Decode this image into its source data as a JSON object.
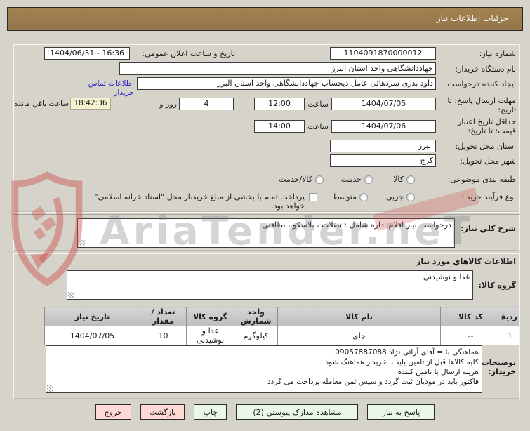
{
  "colors": {
    "header_bg": "#9a7b50",
    "button_green": "#e9f8e9",
    "button_pink": "#fdd8d4",
    "highlight_yellow": "#f6f1cf",
    "link_blue": "#2a24c8"
  },
  "watermark": {
    "text": "AriaTender.neT"
  },
  "header": {
    "title": "جزئیات اطلاعات نیاز"
  },
  "fields": {
    "need_number": {
      "label": "شماره نیاز:",
      "value": "1104091870000012"
    },
    "announce": {
      "label": "تاریخ و ساعت اعلان عمومی:",
      "value": "1404/06/31 - 16:36"
    },
    "buyer_org": {
      "label": "نام دستگاه خریدار:",
      "value": "جهاددانشگاهی واحد استان البرز"
    },
    "creator": {
      "label": "ایجاد کننده درخواست:",
      "value": "داود بدری سردهائی عامل ذیحساب جهاددانشگاهی واحد استان البرز"
    },
    "buyer_contact_link": "اطلاعات تماس خریدار",
    "deadline": {
      "label": "مهلت ارسال پاسخ: تا تاریخ:",
      "date": "1404/07/05",
      "hour_label": "ساعت",
      "time": "12:00",
      "days_value": "4",
      "days_label": "روز و",
      "remaining": "18:42:36",
      "remaining_label": "ساعت باقي مانده"
    },
    "price_validity": {
      "label": "حداقل تاریخ اعتبار قیمت: تا تاریخ:",
      "date": "1404/07/06",
      "hour_label": "ساعت",
      "time": "14:00"
    },
    "province": {
      "label": "استان محل تحویل:",
      "value": "البرز"
    },
    "city": {
      "label": "شهر محل تحویل:",
      "value": "کرج"
    },
    "subject_class": {
      "label": "طبقه بندی موضوعی:",
      "options": [
        "کالا",
        "خدمت",
        "کالا/خدمت"
      ]
    },
    "process_type": {
      "label": "نوع فرآیند خرید :",
      "options": [
        "جزیی",
        "متوسط"
      ],
      "checkbox_label": "پرداخت تمام یا بخشی از مبلغ خرید،از محل \"اسناد خزانه اسلامی\" خواهد بود."
    }
  },
  "need_desc": {
    "label": "شرح کلي نیاز:",
    "value": "درخواست نیاز اقلام اداره شامل : تنقلات ، پلاسکو ، نظافتی"
  },
  "goods": {
    "section_title": "اطلاعات کالاهاي مورد نیاز",
    "group_label": "گروه کالا:",
    "group_value": "غذا و نوشیدنی",
    "table": {
      "headers": [
        "ردیف",
        "کد کالا",
        "نام کالا",
        "واحد شمارش",
        "گروه کالا",
        "تعداد / مقدار",
        "تاریخ نیاز"
      ],
      "rows": [
        [
          "1",
          "--",
          "چای",
          "کیلوگرم",
          "غذا و نوشیدنی",
          "10",
          "1404/07/05"
        ]
      ]
    },
    "notes_label": "توضیحات خریدار:",
    "notes_value": "هماهنگی با = آقای آرائی نژاد 09057887088\nکلیه کالاها قبل از تامین باید با خریدار هماهنگ شود\nهزینه ارسال با تامین کننده\nفاکتور باید در مودیان ثبت گردد و سپس ثمن معامله پرداخت می گردد"
  },
  "buttons": [
    {
      "label": "پاسخ به نیاز",
      "style": "green"
    },
    {
      "label": "مشاهده مدارک پیوستي (2)",
      "style": "green"
    },
    {
      "label": "چاپ",
      "style": "green"
    },
    {
      "label": "بازگشت",
      "style": "pink"
    },
    {
      "label": "خروج",
      "style": "pink"
    }
  ]
}
